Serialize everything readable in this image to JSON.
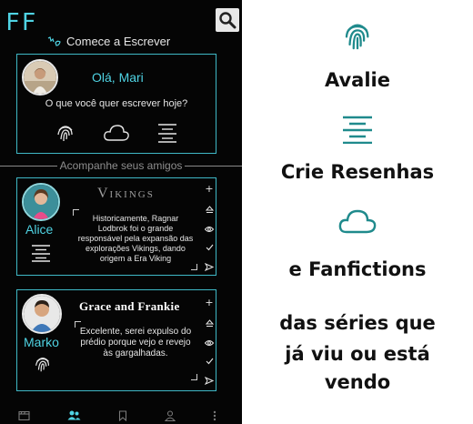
{
  "app": {
    "logo": "FF"
  },
  "header": {
    "start_writing": "Comece a Escrever"
  },
  "write_card": {
    "greeting": "Olá, Mari",
    "question": "O que você quer escrever hoje?",
    "icons": [
      "fingerprint-icon",
      "cloud-icon",
      "align-center-icon"
    ]
  },
  "friends_section": {
    "title": "Acompanhe seus amigos"
  },
  "friends": [
    {
      "name": "Alice",
      "show": "Vikings",
      "review": "Historicamente, Ragnar Lodbrok foi o grande responsável pela expansão das explorações Vikings, dando origem a Era Viking",
      "type_icon": "align-center-icon"
    },
    {
      "name": "Marko",
      "show": "Grace and Frankie",
      "review": "Excelente, serei expulso  do prédio porque vejo e revejo às gargalhadas.",
      "type_icon": "fingerprint-icon"
    }
  ],
  "card_actions": [
    "add-icon",
    "eject-icon",
    "eye-icon",
    "check-icon",
    "send-icon"
  ],
  "bottom_nav": [
    "clapperboard-icon",
    "friends-icon",
    "bookmark-icon",
    "profile-icon",
    "more-icon"
  ],
  "promo": {
    "line1": "Avalie",
    "line2": "Crie Resenhas",
    "line3": "e Fanfictions",
    "line4": "das séries que",
    "line5": "já viu ou está",
    "line6": "vendo"
  },
  "colors": {
    "accent": "#4fd3e3",
    "promo_icon": "#1f8a8c",
    "background": "#050505"
  }
}
